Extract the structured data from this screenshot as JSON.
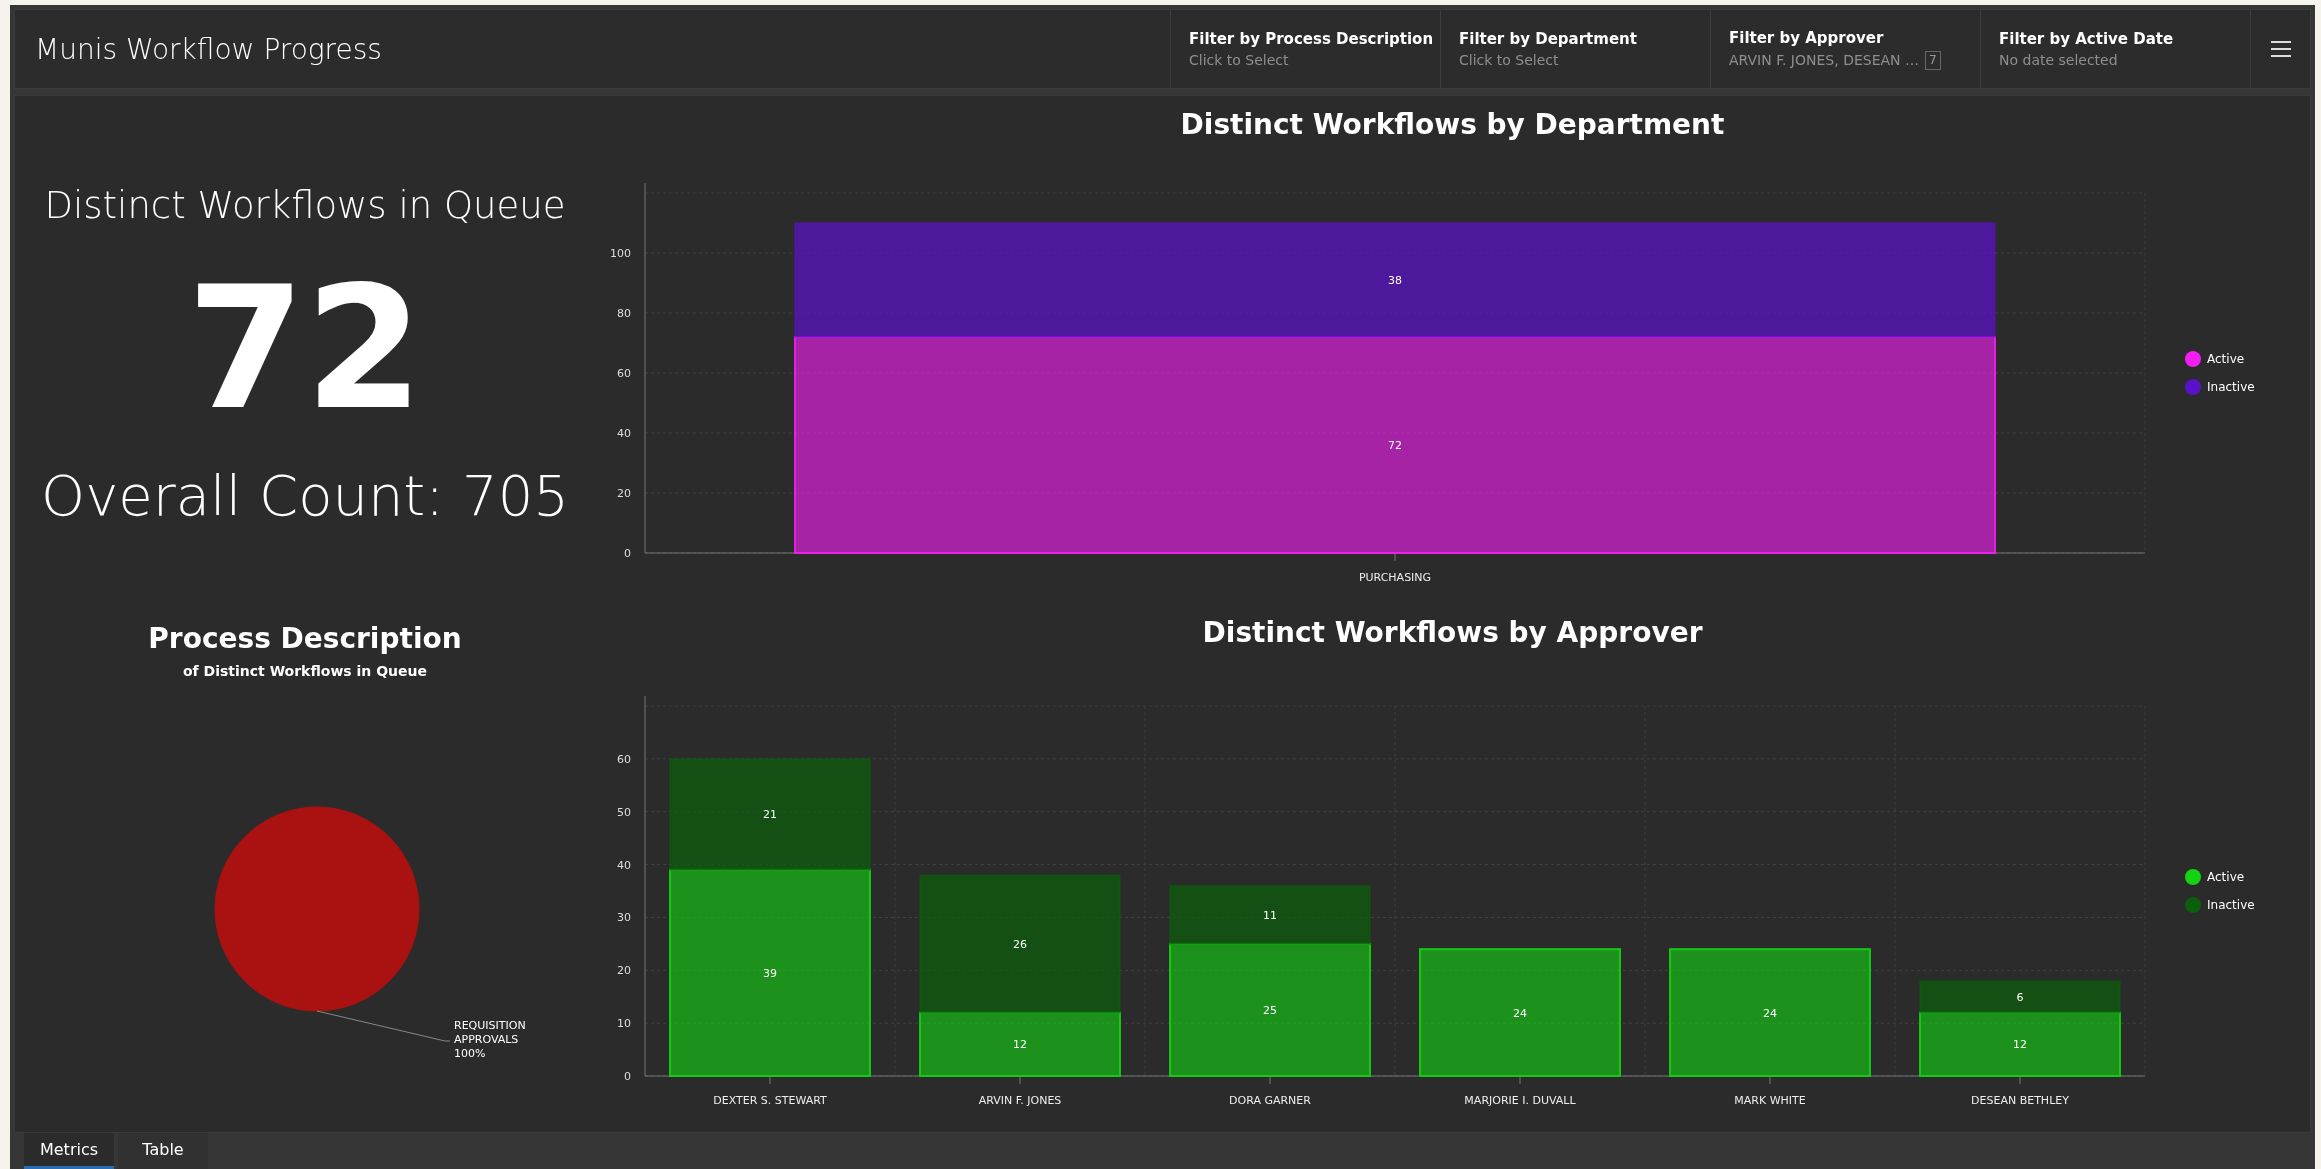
{
  "header": {
    "title": "Munis Workflow Progress",
    "filters": [
      {
        "label": "Filter by Process Description",
        "value": "Click to Select"
      },
      {
        "label": "Filter by Department",
        "value": "Click to Select"
      },
      {
        "label": "Filter by Approver",
        "value": "ARVIN F. JONES, DESEAN …",
        "badge": "7"
      },
      {
        "label": "Filter by Active Date",
        "value": "No date selected"
      }
    ]
  },
  "summary": {
    "title": "Distinct Workflows in Queue",
    "value": "72",
    "overall": "Overall Count: 705"
  },
  "department_chart": {
    "chart_data": {
      "type": "bar",
      "title": "Distinct Workflows by Department",
      "categories": [
        "PURCHASING"
      ],
      "stacked": true,
      "grid": true,
      "data_labels": true,
      "ylim": [
        0,
        120
      ],
      "yticks": [
        0,
        20,
        40,
        60,
        80,
        100
      ],
      "series": [
        {
          "name": "Active",
          "color": "#f21ef2",
          "values": [
            72
          ]
        },
        {
          "name": "Inactive",
          "color": "#5a12c8",
          "values": [
            38
          ]
        }
      ]
    }
  },
  "process_chart": {
    "subtitle": "of Distinct Workflows in Queue",
    "chart_data": {
      "type": "pie",
      "title": "Process Description",
      "categories": [
        "REQUISITION APPROVALS"
      ],
      "values": [
        100
      ],
      "value_labels": [
        "100%"
      ],
      "colors": [
        "#aa1111"
      ]
    }
  },
  "approver_chart": {
    "chart_data": {
      "type": "bar",
      "title": "Distinct Workflows by Approver",
      "categories": [
        "DEXTER S. STEWART",
        "ARVIN F. JONES",
        "DORA GARNER",
        "MARJORIE I. DUVALL",
        "MARK WHITE",
        "DESEAN BETHLEY"
      ],
      "stacked": true,
      "grid": true,
      "data_labels": true,
      "ylim": [
        0,
        70
      ],
      "yticks": [
        0,
        10,
        20,
        30,
        40,
        50,
        60
      ],
      "series": [
        {
          "name": "Active",
          "color": "#14d214",
          "values": [
            39,
            12,
            25,
            24,
            24,
            12
          ]
        },
        {
          "name": "Inactive",
          "color": "#0b5e0b",
          "values": [
            21,
            26,
            11,
            null,
            null,
            6
          ]
        }
      ]
    }
  },
  "tabs": [
    {
      "label": "Metrics",
      "selected": true
    },
    {
      "label": "Table",
      "selected": false
    }
  ]
}
